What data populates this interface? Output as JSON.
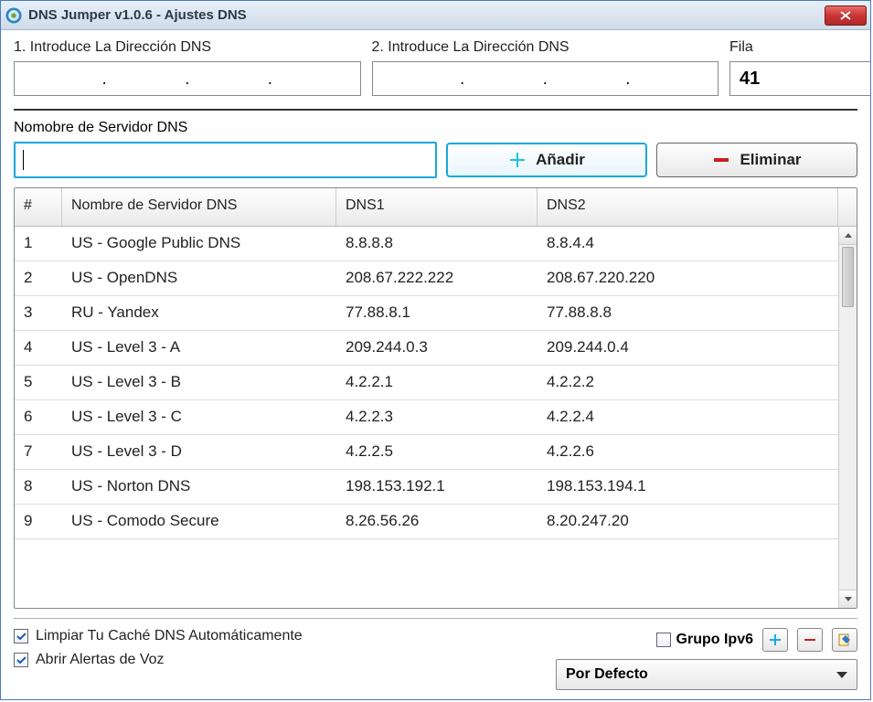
{
  "window": {
    "title": "DNS Jumper v1.0.6 -  Ajustes DNS"
  },
  "inputs": {
    "dns1_label": "1. Introduce La Dirección DNS",
    "dns2_label": "2. Introduce La Dirección DNS",
    "fila_label": "Fila",
    "fila_value": "41",
    "server_name_label": "Nomobre de Servidor DNS",
    "server_name_value": ""
  },
  "buttons": {
    "add": "Añadir",
    "delete": "Eliminar"
  },
  "table": {
    "headers": {
      "num": "#",
      "name": "Nombre de Servidor DNS",
      "dns1": "DNS1",
      "dns2": "DNS2"
    },
    "rows": [
      {
        "num": "1",
        "name": "US - Google Public DNS",
        "dns1": "8.8.8.8",
        "dns2": "8.8.4.4"
      },
      {
        "num": "2",
        "name": "US - OpenDNS",
        "dns1": "208.67.222.222",
        "dns2": "208.67.220.220"
      },
      {
        "num": "3",
        "name": "RU - Yandex",
        "dns1": "77.88.8.1",
        "dns2": "77.88.8.8"
      },
      {
        "num": "4",
        "name": "US - Level 3 - A",
        "dns1": "209.244.0.3",
        "dns2": "209.244.0.4"
      },
      {
        "num": "5",
        "name": "US - Level 3 - B",
        "dns1": "4.2.2.1",
        "dns2": "4.2.2.2"
      },
      {
        "num": "6",
        "name": "US - Level 3 - C",
        "dns1": "4.2.2.3",
        "dns2": "4.2.2.4"
      },
      {
        "num": "7",
        "name": "US - Level 3 - D",
        "dns1": "4.2.2.5",
        "dns2": "4.2.2.6"
      },
      {
        "num": "8",
        "name": "US - Norton DNS",
        "dns1": "198.153.192.1",
        "dns2": "198.153.194.1"
      },
      {
        "num": "9",
        "name": "US - Comodo Secure",
        "dns1": "8.26.56.26",
        "dns2": "8.20.247.20"
      }
    ]
  },
  "options": {
    "clear_cache": "Limpiar Tu Caché DNS Automáticamente",
    "voice_alerts": "Abrir Alertas de Voz",
    "group_ipv6": "Grupo Ipv6",
    "default_group": "Por Defecto"
  }
}
